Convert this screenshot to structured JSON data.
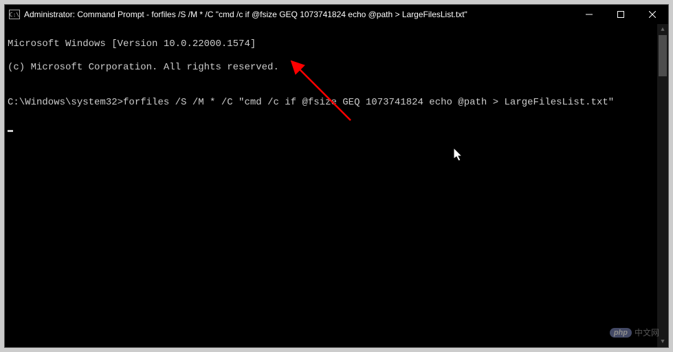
{
  "window": {
    "icon_label": "C:\\",
    "title": "Administrator: Command Prompt - forfiles  /S /M * /C \"cmd /c if @fsize GEQ 1073741824 echo @path > LargeFilesList.txt\""
  },
  "terminal": {
    "line1": "Microsoft Windows [Version 10.0.22000.1574]",
    "line2": "(c) Microsoft Corporation. All rights reserved.",
    "blank": "",
    "prompt": "C:\\Windows\\system32>",
    "command": "forfiles /S /M * /C \"cmd /c if @fsize GEQ 1073741824 echo @path > LargeFilesList.txt\""
  },
  "watermark": {
    "badge": "php",
    "text": "中文网"
  }
}
